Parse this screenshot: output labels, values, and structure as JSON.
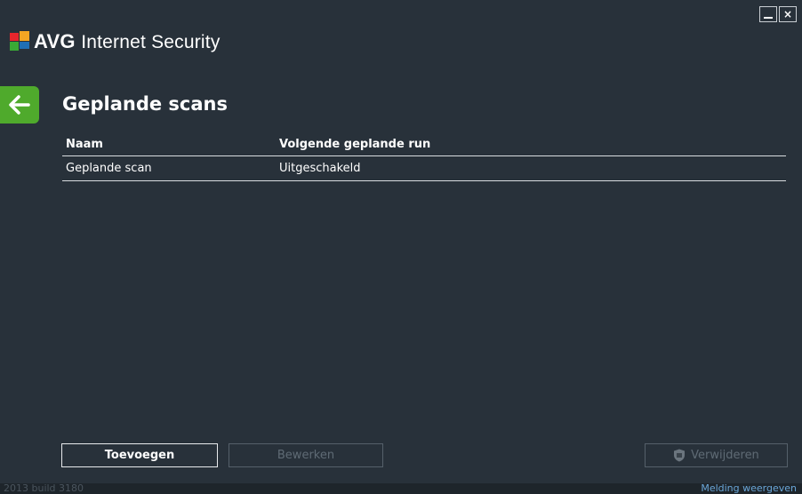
{
  "app": {
    "brand": "AVG",
    "product": "Internet Security",
    "logo_colors": [
      "#e8262c",
      "#f5a623",
      "#3aa935",
      "#1f6fb5"
    ]
  },
  "window_controls": {
    "minimize_icon": "minimize-icon",
    "close_label": "×"
  },
  "page": {
    "title": "Geplande scans",
    "back_icon": "arrow-left-icon"
  },
  "table": {
    "columns": [
      "Naam",
      "Volgende geplande run"
    ],
    "rows": [
      [
        "Geplande scan",
        "Uitgeschakeld"
      ]
    ]
  },
  "buttons": {
    "add": "Toevoegen",
    "edit": "Bewerken",
    "delete": "Verwijderen",
    "delete_icon": "shield-icon"
  },
  "footer": {
    "build": "2013  build 3180",
    "notification_link": "Melding weergeven"
  },
  "colors": {
    "background": "#28313a",
    "accent_green": "#4faa2c",
    "link_blue": "#6aa6d8"
  }
}
